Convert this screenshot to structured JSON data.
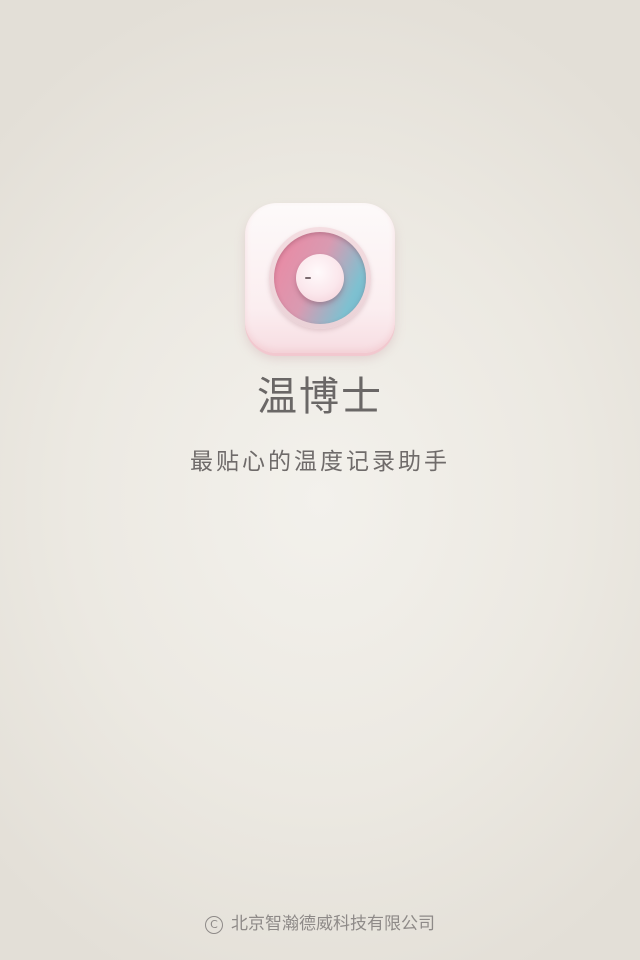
{
  "app": {
    "title": "温博士",
    "tagline": "最贴心的温度记录助手"
  },
  "icon": {
    "name": "thermometer-dial-icon",
    "colors": {
      "tile": "#fbeef0",
      "dial_pink": "#ee86a1",
      "dial_blue": "#6db9cd"
    }
  },
  "footer": {
    "copyright_symbol": "C",
    "company": "北京智瀚德威科技有限公司"
  },
  "colors": {
    "background": "#ece9e2",
    "text": "#6a6766",
    "footer_text": "#8e8a88"
  }
}
